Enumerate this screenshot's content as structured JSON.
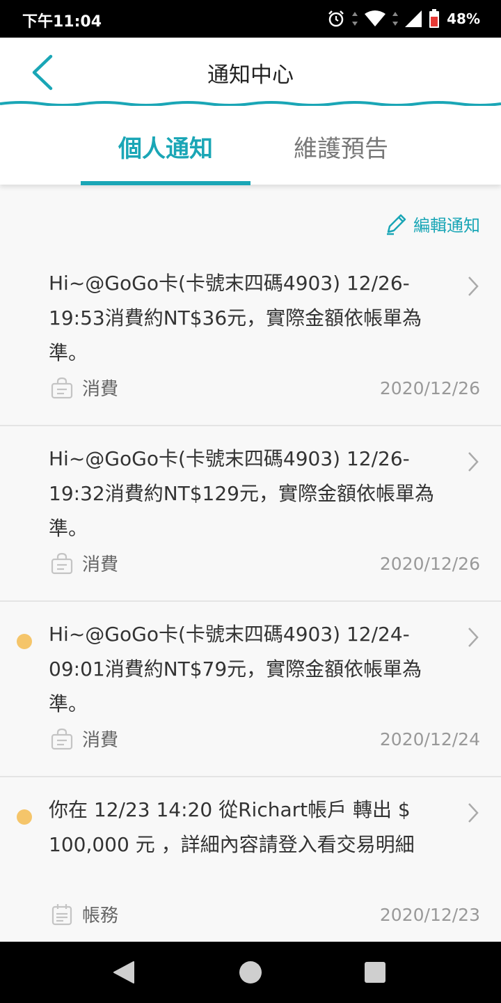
{
  "status_bar": {
    "time": "下午11:04",
    "battery": "48%",
    "icons": [
      "alarm-icon",
      "wifi-icon",
      "signal-icon",
      "battery-icon"
    ]
  },
  "header": {
    "title": "通知中心",
    "back_icon": "chevron-left-icon"
  },
  "tabs": [
    {
      "label": "個人通知",
      "active": true
    },
    {
      "label": "維護預告",
      "active": false
    }
  ],
  "edit": {
    "label": "編輯通知",
    "icon": "pencil-icon"
  },
  "notifications": [
    {
      "message": "Hi~@GoGo卡(卡號末四碼4903) 12/26-19:53消費約NT$36元，實際金額依帳單為準。",
      "category": "消費",
      "category_icon": "shopping-bag-icon",
      "date": "2020/12/26",
      "unread": false
    },
    {
      "message": "Hi~@GoGo卡(卡號末四碼4903) 12/26-19:32消費約NT$129元，實際金額依帳單為準。",
      "category": "消費",
      "category_icon": "shopping-bag-icon",
      "date": "2020/12/26",
      "unread": false
    },
    {
      "message": "Hi~@GoGo卡(卡號末四碼4903) 12/24-09:01消費約NT$79元，實際金額依帳單為準。",
      "category": "消費",
      "category_icon": "shopping-bag-icon",
      "date": "2020/12/24",
      "unread": true
    },
    {
      "message": "你在 12/23 14:20 從Richart帳戶 轉出 $ 100,000 元 ，詳細內容請登入看交易明細",
      "category": "帳務",
      "category_icon": "calendar-icon",
      "date": "2020/12/23",
      "unread": true
    }
  ],
  "colors": {
    "accent": "#1aa6b6",
    "unread_dot": "#f5c56a",
    "background": "#f8f8f8"
  },
  "nav_bar": [
    "back-triangle-icon",
    "home-circle-icon",
    "recents-square-icon"
  ]
}
